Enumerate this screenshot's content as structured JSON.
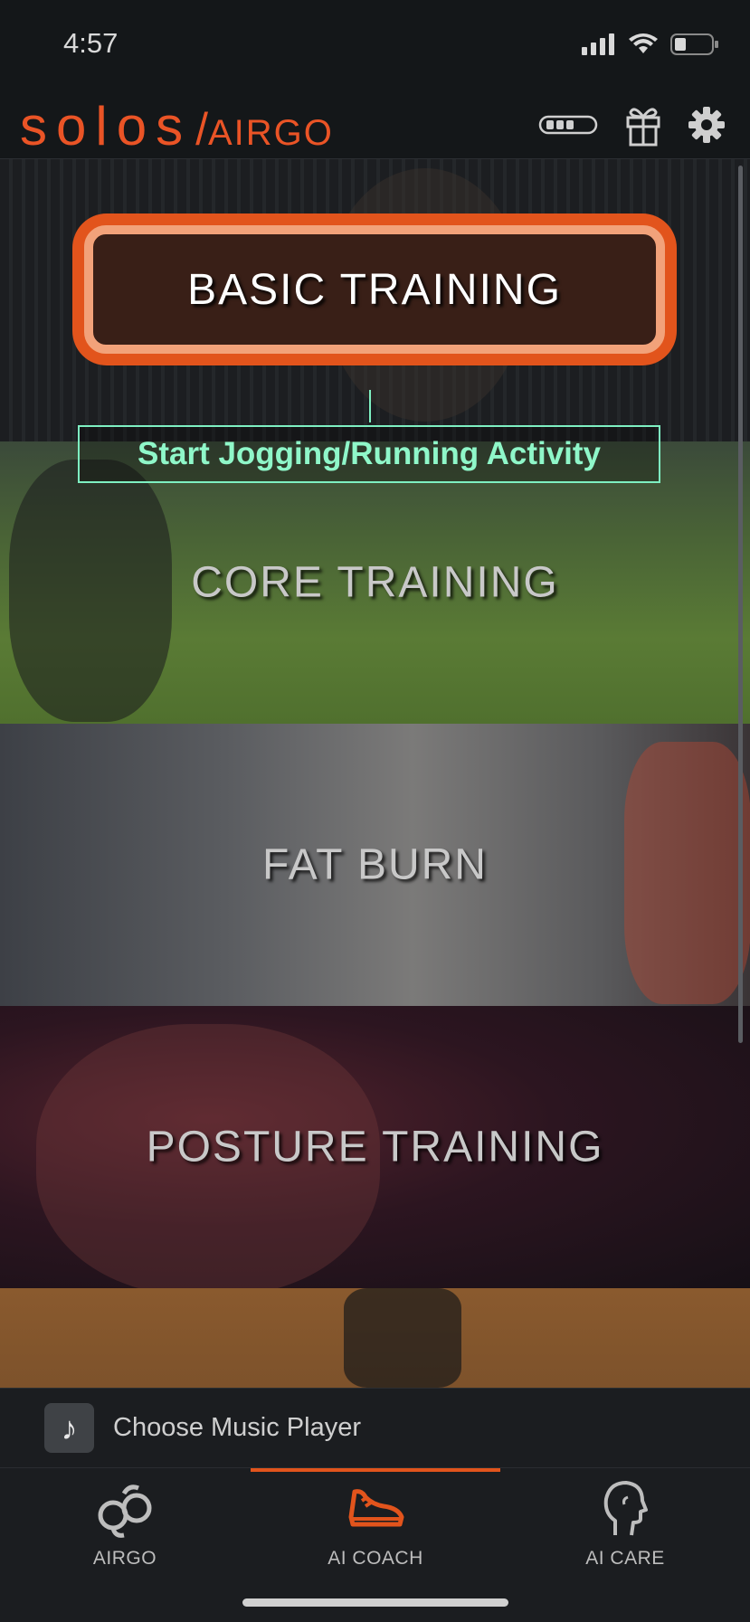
{
  "status": {
    "time": "4:57"
  },
  "header": {
    "logo_main": "solos",
    "logo_slash": "/",
    "logo_sub": "AIRGO"
  },
  "cards": [
    {
      "title": "BASIC TRAINING"
    },
    {
      "title": "CORE TRAINING"
    },
    {
      "title": "FAT BURN"
    },
    {
      "title": "POSTURE TRAINING"
    }
  ],
  "tooltip": {
    "text": "Start Jogging/Running Activity"
  },
  "music": {
    "label": "Choose Music Player"
  },
  "tabs": [
    {
      "label": "AIRGO",
      "icon": "airgo-glasses-icon"
    },
    {
      "label": "AI COACH",
      "icon": "running-shoe-icon",
      "active": true
    },
    {
      "label": "AI CARE",
      "icon": "head-profile-icon"
    }
  ],
  "colors": {
    "accent": "#e2541c",
    "tooltip": "#7ef0c2",
    "background": "#141719"
  }
}
